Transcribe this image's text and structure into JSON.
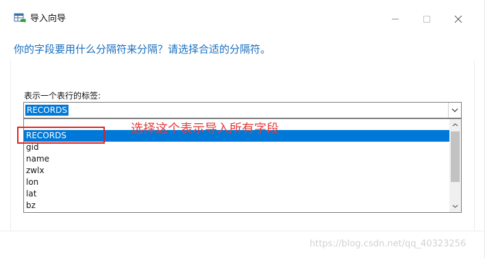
{
  "window": {
    "title": "导入向导",
    "icon": "table-import-icon"
  },
  "controls": {
    "minimize": "minimize-icon",
    "maximize": "maximize-icon",
    "close": "close-icon"
  },
  "wizard": {
    "question": "你的字段要用什么分隔符来分隔？请选择合适的分隔符。",
    "row_tag_label": "表示一个表行的标签:",
    "selected_value": "RECORDS",
    "options": [
      "RECORDS",
      "gid",
      "name",
      "zwlx",
      "lon",
      "lat",
      "bz"
    ],
    "selected_index": 0
  },
  "annotation": {
    "text": "选择这个表示导入所有字段",
    "color": "#e02020"
  },
  "watermark": "https://blog.csdn.net/qq_40323256",
  "colors": {
    "accent": "#0078d7",
    "question_text": "#1a6fbf"
  }
}
